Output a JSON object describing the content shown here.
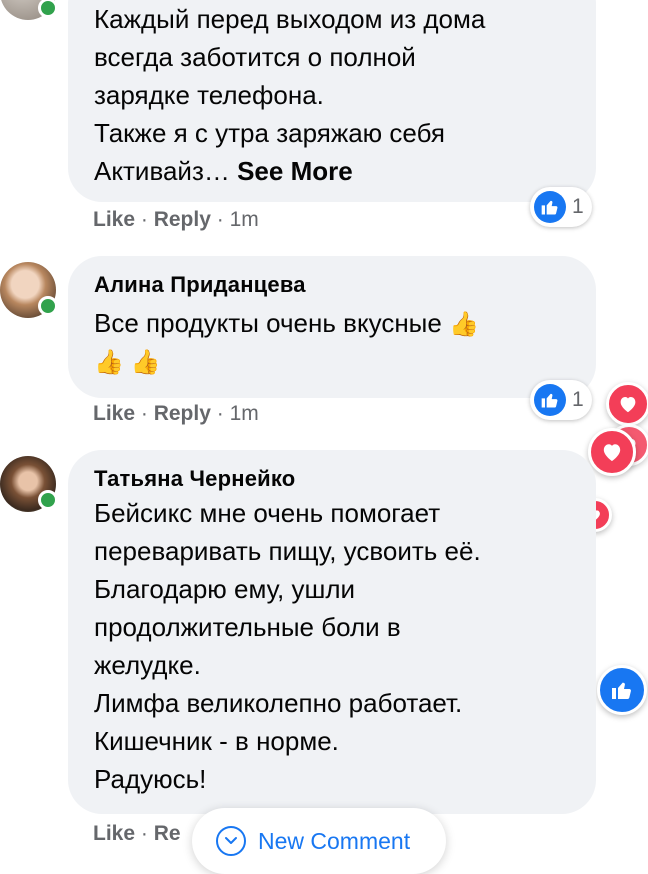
{
  "comments": [
    {
      "author": "",
      "lines": [
        "Каждый перед выходом из дома",
        "всегда заботится о полной",
        "зарядке телефона.",
        "Также я с утра заряжаю себя"
      ],
      "last_line": "Активайз… ",
      "see_more": "See More",
      "like_label": "Like",
      "sep": " · ",
      "reply_label": "Reply",
      "time": "1m",
      "reaction_count": "1",
      "online": true
    },
    {
      "author": "Алина Приданцева",
      "lines": [
        "Все продукты очень вкусные"
      ],
      "emoji_line": "👍 👍",
      "trail_emoji": "👍",
      "like_label": "Like",
      "sep": " · ",
      "reply_label": "Reply",
      "time": "1m",
      "reaction_count": "1",
      "online": true
    },
    {
      "author": "Татьяна Чернейко",
      "lines": [
        "Бейсикс мне очень помогает",
        "переваривать пищу, усвоить её.",
        "Благодарю ему, ушли",
        "продолжительные боли в",
        "желудке.",
        "Лимфа великолепно работает.",
        "Кишечник - в норме.",
        "Радуюсь!"
      ],
      "like_label": "Like",
      "sep": " · ",
      "reply_label": "Re",
      "online": true
    }
  ],
  "new_comment_label": "New Comment",
  "colors": {
    "bubble": "#f0f2f5",
    "meta": "#65676b",
    "accent": "#1877f2",
    "heart": "#f33e58",
    "online": "#31a24c"
  },
  "icons": {
    "like_badge": "thumbs-up-icon",
    "heart": "heart-icon",
    "new_comment": "chevron-down-icon"
  }
}
